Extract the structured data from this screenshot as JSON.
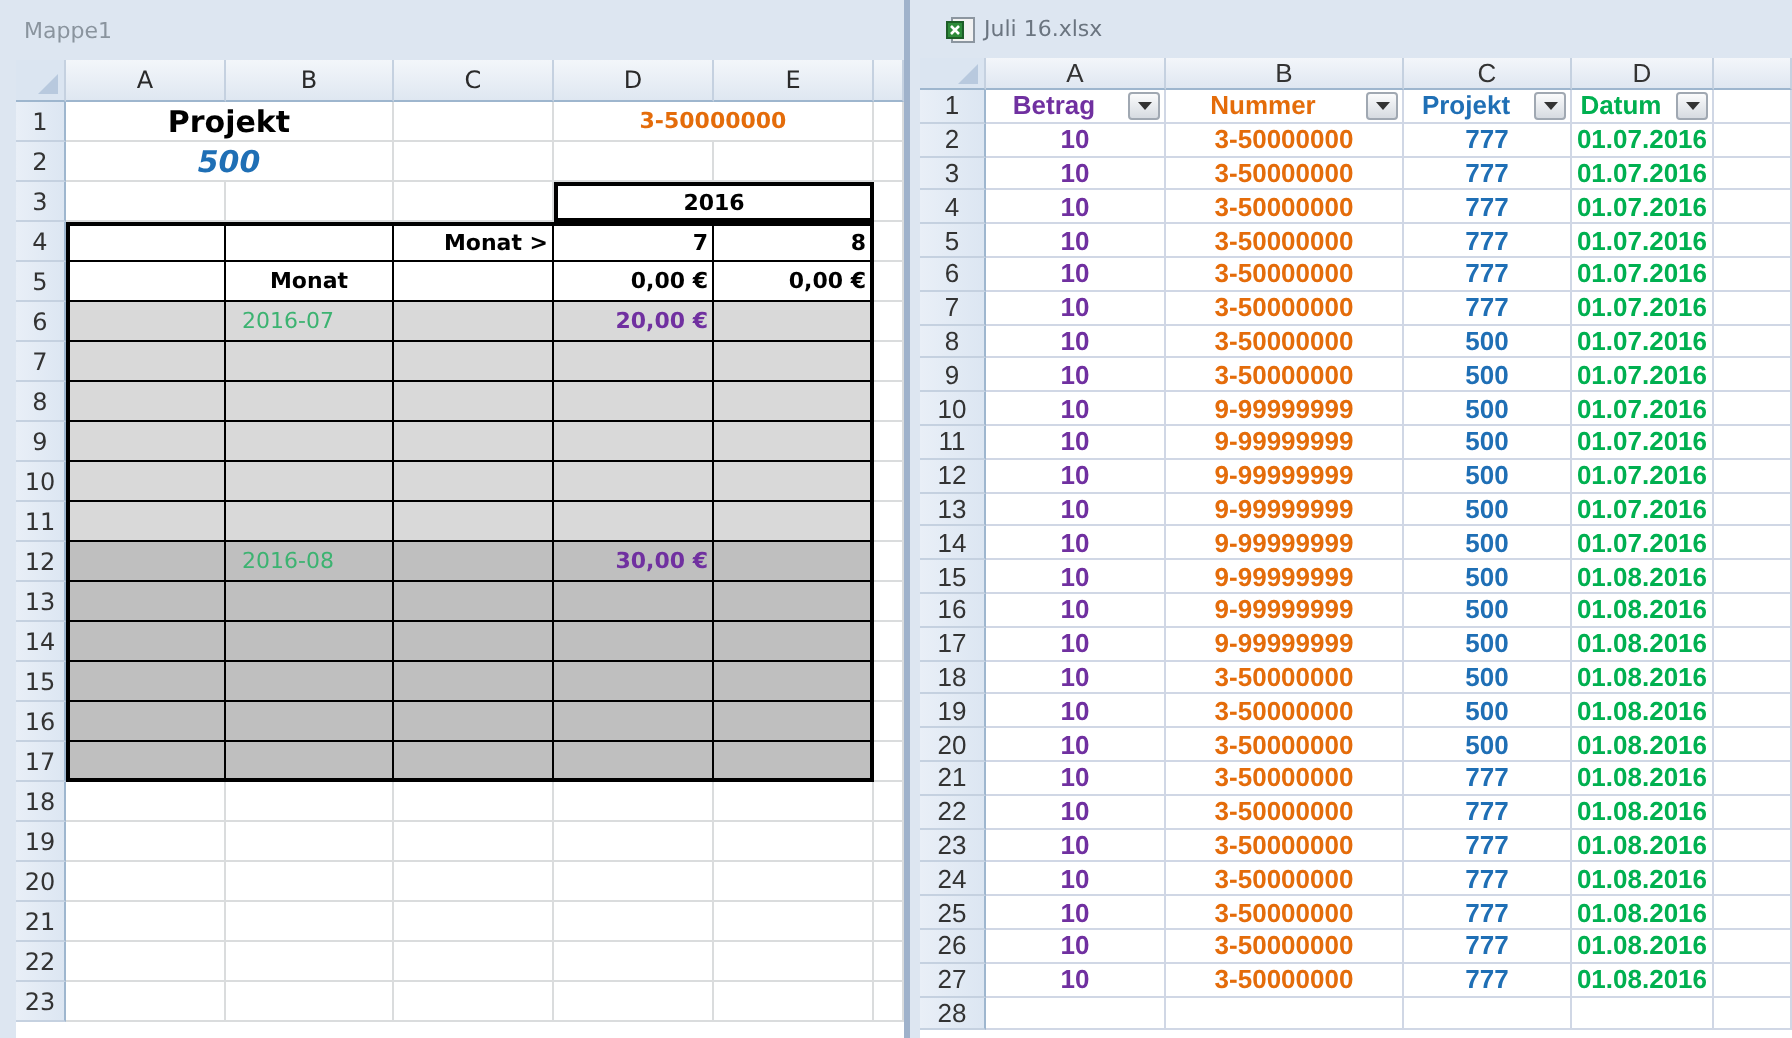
{
  "left_window": {
    "title": "Mappe1",
    "columns": [
      "A",
      "B",
      "C",
      "D",
      "E"
    ],
    "rows": [
      {
        "number": "1",
        "color": "#ffffff",
        "framed": false,
        "cells": [
          {
            "text": "Projekt",
            "kind": "title",
            "merged": true,
            "color": "#000000"
          },
          null,
          null,
          {
            "text": "3-50000000",
            "kind": "code",
            "merged": true,
            "color": "#e46c0a"
          },
          null
        ]
      },
      {
        "number": "2",
        "color": "#ffffff",
        "framed": false,
        "cells": [
          {
            "text": "500",
            "kind": "project",
            "merged": true,
            "color": "#1f6fb5"
          },
          null,
          null,
          null,
          null
        ]
      },
      {
        "number": "3",
        "color": "#ffffff",
        "framed": false,
        "cells": [
          null,
          null,
          null,
          {
            "text": "2016",
            "kind": "heading",
            "merged": true,
            "color": "#000000",
            "framed": true
          },
          null
        ]
      },
      {
        "number": "4",
        "color": "#ffffff",
        "framed": true,
        "cells": [
          null,
          null,
          {
            "text": "Monat >",
            "kind": "label",
            "merged": false,
            "color": "#000000"
          },
          {
            "text": "7",
            "kind": "label",
            "merged": false,
            "color": "#000000"
          },
          {
            "text": "8",
            "kind": "label",
            "merged": false,
            "color": "#000000"
          }
        ]
      },
      {
        "number": "5",
        "color": "#ffffff",
        "framed": true,
        "cells": [
          null,
          {
            "text": "Monat",
            "kind": "heading",
            "merged": false,
            "color": "#000000"
          },
          null,
          {
            "text": "0,00 €",
            "kind": "label",
            "merged": false,
            "color": "#000000"
          },
          {
            "text": "0,00 €",
            "kind": "label",
            "merged": false,
            "color": "#000000"
          }
        ]
      },
      {
        "number": "6",
        "color": "#d9d9d9",
        "framed": true,
        "cells": [
          null,
          {
            "text": "2016-07",
            "kind": "date",
            "merged": false,
            "color": "#3cb371"
          },
          null,
          {
            "text": "20,00 €",
            "kind": "label",
            "merged": false,
            "color": "#7030a0"
          },
          null
        ]
      },
      {
        "number": "7",
        "color": "#d9d9d9",
        "framed": true,
        "cells": [
          null,
          null,
          null,
          null,
          null
        ]
      },
      {
        "number": "8",
        "color": "#d9d9d9",
        "framed": true,
        "cells": [
          null,
          null,
          null,
          null,
          null
        ]
      },
      {
        "number": "9",
        "color": "#d9d9d9",
        "framed": true,
        "cells": [
          null,
          null,
          null,
          null,
          null
        ]
      },
      {
        "number": "10",
        "color": "#d9d9d9",
        "framed": true,
        "cells": [
          null,
          null,
          null,
          null,
          null
        ]
      },
      {
        "number": "11",
        "color": "#d9d9d9",
        "framed": true,
        "cells": [
          null,
          null,
          null,
          null,
          null
        ]
      },
      {
        "number": "12",
        "color": "#bfbfbf",
        "framed": true,
        "cells": [
          null,
          {
            "text": "2016-08",
            "kind": "date",
            "merged": false,
            "color": "#3cb371"
          },
          null,
          {
            "text": "30,00 €",
            "kind": "label",
            "merged": false,
            "color": "#7030a0"
          },
          null
        ]
      },
      {
        "number": "13",
        "color": "#bfbfbf",
        "framed": true,
        "cells": [
          null,
          null,
          null,
          null,
          null
        ]
      },
      {
        "number": "14",
        "color": "#bfbfbf",
        "framed": true,
        "cells": [
          null,
          null,
          null,
          null,
          null
        ]
      },
      {
        "number": "15",
        "color": "#bfbfbf",
        "framed": true,
        "cells": [
          null,
          null,
          null,
          null,
          null
        ]
      },
      {
        "number": "16",
        "color": "#bfbfbf",
        "framed": true,
        "cells": [
          null,
          null,
          null,
          null,
          null
        ]
      },
      {
        "number": "17",
        "color": "#bfbfbf",
        "framed": true,
        "cells": [
          null,
          null,
          null,
          null,
          null
        ]
      },
      {
        "number": "18",
        "color": "#ffffff",
        "framed": false,
        "cells": [
          null,
          null,
          null,
          null,
          null
        ]
      },
      {
        "number": "19",
        "color": "#ffffff",
        "framed": false,
        "cells": [
          null,
          null,
          null,
          null,
          null
        ]
      },
      {
        "number": "20",
        "color": "#ffffff",
        "framed": false,
        "cells": [
          null,
          null,
          null,
          null,
          null
        ]
      },
      {
        "number": "21",
        "color": "#ffffff",
        "framed": false,
        "cells": [
          null,
          null,
          null,
          null,
          null
        ]
      },
      {
        "number": "22",
        "color": "#ffffff",
        "framed": false,
        "cells": [
          null,
          null,
          null,
          null,
          null
        ]
      },
      {
        "number": "23",
        "color": "#ffffff",
        "framed": false,
        "cells": [
          null,
          null,
          null,
          null,
          null
        ]
      }
    ]
  },
  "right_window": {
    "title": "Juli 16.xlsx",
    "columns": [
      {
        "letter": "A",
        "color": "#7030a0"
      },
      {
        "letter": "B",
        "color": "#e46c0a"
      },
      {
        "letter": "C",
        "color": "#1f6fb5"
      },
      {
        "letter": "D",
        "color": "#00b050"
      }
    ],
    "header_row": {
      "number": "1",
      "cells": [
        {
          "text": "Betrag",
          "filter": true
        },
        {
          "text": "Nummer",
          "filter": true
        },
        {
          "text": "Projekt",
          "filter": true
        },
        {
          "text": "Datum",
          "filter": true
        }
      ]
    },
    "rows": [
      {
        "number": "2",
        "cells": [
          "10",
          "3-50000000",
          "777",
          "01.07.2016"
        ]
      },
      {
        "number": "3",
        "cells": [
          "10",
          "3-50000000",
          "777",
          "01.07.2016"
        ]
      },
      {
        "number": "4",
        "cells": [
          "10",
          "3-50000000",
          "777",
          "01.07.2016"
        ]
      },
      {
        "number": "5",
        "cells": [
          "10",
          "3-50000000",
          "777",
          "01.07.2016"
        ]
      },
      {
        "number": "6",
        "cells": [
          "10",
          "3-50000000",
          "777",
          "01.07.2016"
        ]
      },
      {
        "number": "7",
        "cells": [
          "10",
          "3-50000000",
          "777",
          "01.07.2016"
        ]
      },
      {
        "number": "8",
        "cells": [
          "10",
          "3-50000000",
          "500",
          "01.07.2016"
        ]
      },
      {
        "number": "9",
        "cells": [
          "10",
          "3-50000000",
          "500",
          "01.07.2016"
        ]
      },
      {
        "number": "10",
        "cells": [
          "10",
          "9-99999999",
          "500",
          "01.07.2016"
        ]
      },
      {
        "number": "11",
        "cells": [
          "10",
          "9-99999999",
          "500",
          "01.07.2016"
        ]
      },
      {
        "number": "12",
        "cells": [
          "10",
          "9-99999999",
          "500",
          "01.07.2016"
        ]
      },
      {
        "number": "13",
        "cells": [
          "10",
          "9-99999999",
          "500",
          "01.07.2016"
        ]
      },
      {
        "number": "14",
        "cells": [
          "10",
          "9-99999999",
          "500",
          "01.07.2016"
        ]
      },
      {
        "number": "15",
        "cells": [
          "10",
          "9-99999999",
          "500",
          "01.08.2016"
        ]
      },
      {
        "number": "16",
        "cells": [
          "10",
          "9-99999999",
          "500",
          "01.08.2016"
        ]
      },
      {
        "number": "17",
        "cells": [
          "10",
          "9-99999999",
          "500",
          "01.08.2016"
        ]
      },
      {
        "number": "18",
        "cells": [
          "10",
          "3-50000000",
          "500",
          "01.08.2016"
        ]
      },
      {
        "number": "19",
        "cells": [
          "10",
          "3-50000000",
          "500",
          "01.08.2016"
        ]
      },
      {
        "number": "20",
        "cells": [
          "10",
          "3-50000000",
          "500",
          "01.08.2016"
        ]
      },
      {
        "number": "21",
        "cells": [
          "10",
          "3-50000000",
          "777",
          "01.08.2016"
        ]
      },
      {
        "number": "22",
        "cells": [
          "10",
          "3-50000000",
          "777",
          "01.08.2016"
        ]
      },
      {
        "number": "23",
        "cells": [
          "10",
          "3-50000000",
          "777",
          "01.08.2016"
        ]
      },
      {
        "number": "24",
        "cells": [
          "10",
          "3-50000000",
          "777",
          "01.08.2016"
        ]
      },
      {
        "number": "25",
        "cells": [
          "10",
          "3-50000000",
          "777",
          "01.08.2016"
        ]
      },
      {
        "number": "26",
        "cells": [
          "10",
          "3-50000000",
          "777",
          "01.08.2016"
        ]
      },
      {
        "number": "27",
        "cells": [
          "10",
          "3-50000000",
          "777",
          "01.08.2016"
        ]
      },
      {
        "number": "28",
        "cells": []
      }
    ]
  }
}
